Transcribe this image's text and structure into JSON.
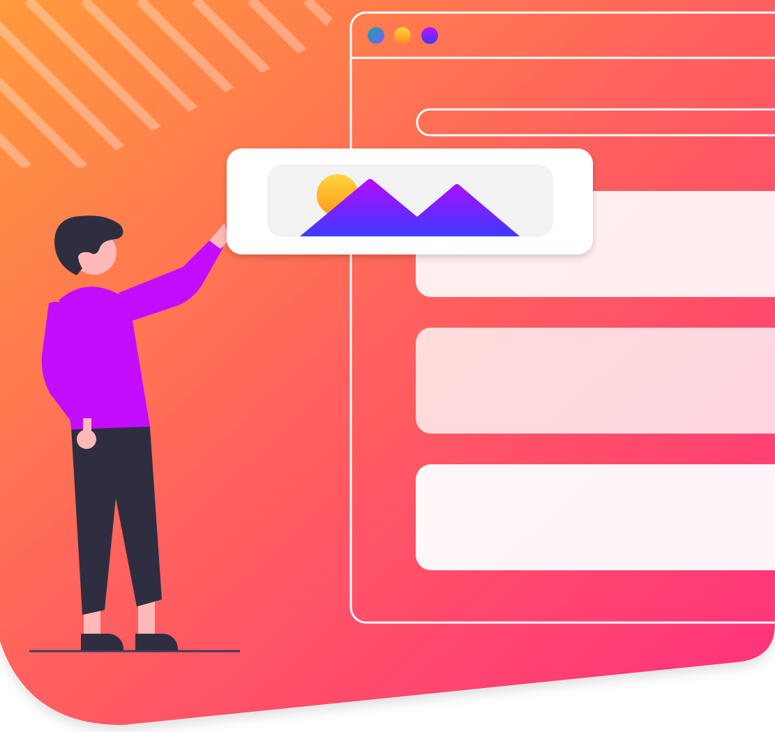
{
  "colors": {
    "background_start": "#ff9a3c",
    "background_mid": "#ff5f5f",
    "background_end": "#ff2e7e",
    "window_stroke": "#ffffff",
    "shirt": "#c40cff",
    "pants": "#2f2e41",
    "skin": "#ffb8b8",
    "hair": "#2f2e41",
    "mountain_top": "#b40cff",
    "mountain_bottom": "#3d3bff",
    "sun_top": "#ffd43b",
    "sun_bottom": "#ff9a1c",
    "placeholder_bg": "#f2f2f2"
  },
  "illustration": {
    "window_dots": [
      "teal-blue",
      "yellow-orange",
      "purple-blue"
    ],
    "content_cards": 3,
    "icons": [
      "image-placeholder-icon"
    ]
  }
}
